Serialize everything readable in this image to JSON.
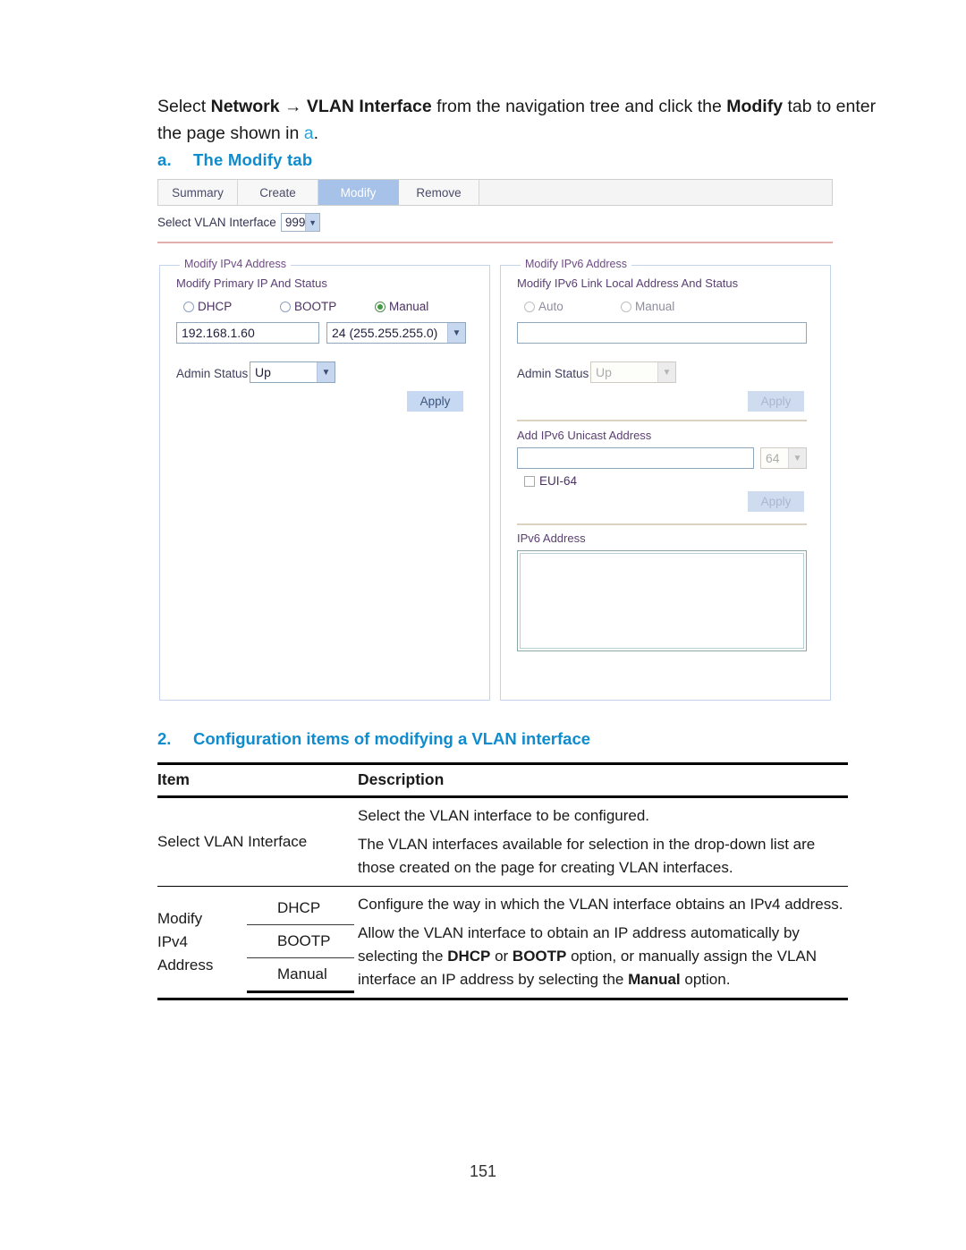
{
  "document": {
    "intro_prefix": "Select ",
    "intro_nav_1": "Network",
    "intro_arrow": " → ",
    "intro_nav_2": "VLAN Interface",
    "intro_mid": " from the navigation tree and click the ",
    "intro_bold_tab": "Modify",
    "intro_suffix": " tab to enter the page shown in ",
    "intro_ref": "a",
    "intro_period": ".",
    "figure_marker": "a.",
    "figure_title": "The Modify tab",
    "page_number": "151"
  },
  "app": {
    "tabs": [
      {
        "label": "Summary",
        "active": false
      },
      {
        "label": "Create",
        "active": false
      },
      {
        "label": "Modify",
        "active": true
      },
      {
        "label": "Remove",
        "active": false
      }
    ],
    "select_vlan": {
      "label": "Select VLAN Interface",
      "value": "999"
    },
    "ipv4_panel": {
      "legend": "Modify IPv4 Address",
      "section_title": "Modify Primary IP And Status",
      "radios": [
        {
          "label": "DHCP",
          "selected": false
        },
        {
          "label": "BOOTP",
          "selected": false
        },
        {
          "label": "Manual",
          "selected": true
        }
      ],
      "ip_value": "192.168.1.60",
      "ip_placeholder": "",
      "mask_value": "24 (255.255.255.0)",
      "admin_status_label": "Admin Status",
      "admin_status_value": "Up",
      "apply_label": "Apply"
    },
    "ipv6_panel": {
      "legend": "Modify IPv6 Address",
      "link_local": {
        "section_title": "Modify IPv6 Link Local Address And Status",
        "radios": [
          {
            "label": "Auto",
            "selected": false
          },
          {
            "label": "Manual",
            "selected": false
          }
        ],
        "address_value": "",
        "address_placeholder": "",
        "admin_status_label": "Admin Status",
        "admin_status_value": "Up",
        "apply_label": "Apply"
      },
      "unicast": {
        "section_title": "Add IPv6 Unicast Address",
        "address_value": "",
        "address_placeholder": "",
        "prefix_value": "64",
        "eui64_label": "EUI-64",
        "eui64_checked": false,
        "apply_label": "Apply"
      },
      "list": {
        "section_title": "IPv6 Address",
        "content": ""
      }
    },
    "colors": {
      "active_tab_bg": "#a7c2e8",
      "apply_bg": "#c6d8f2",
      "panel_border": "#c3d4ec",
      "divider_red": "#e0aeab",
      "radio_selected": "#3f9b3f"
    }
  },
  "table": {
    "marker": "2.",
    "caption": "Configuration items of modifying a VLAN interface",
    "headers": [
      "Item",
      "Description"
    ],
    "rows": [
      {
        "item": "Select VLAN Interface",
        "subitems": [],
        "description_lines": [
          "Select the VLAN interface to be configured.",
          "The VLAN interfaces available for selection in the drop-down list are those created on the page for creating VLAN interfaces."
        ]
      },
      {
        "item_lines": [
          "Modify",
          "IPv4",
          "Address"
        ],
        "subitems": [
          "DHCP",
          "BOOTP",
          "Manual"
        ],
        "description_lines": [
          "Configure the way in which the VLAN interface obtains an IPv4 address.",
          "Allow the VLAN interface to obtain an IP address automatically by selecting the DHCP or BOOTP option, or manually assign the VLAN interface an IP address by selecting the Manual option."
        ]
      }
    ]
  }
}
